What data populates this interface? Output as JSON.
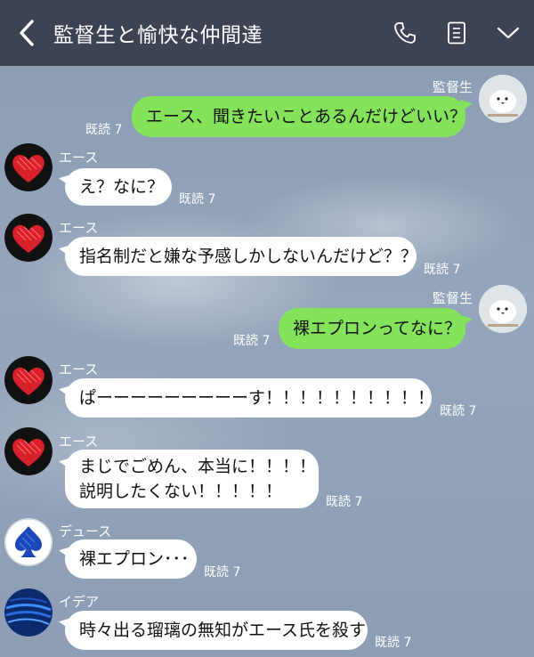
{
  "header": {
    "title": "監督生と愉快な仲間達",
    "back_icon": "chevron-left-icon",
    "call_icon": "phone-icon",
    "notes_icon": "notes-icon",
    "menu_icon": "chevron-down-icon"
  },
  "colors": {
    "header_bg": "#3e4354",
    "outgoing_bubble": "#84e25b",
    "incoming_bubble": "#ffffff",
    "chat_bg": "#8e9fb6"
  },
  "messages": [
    {
      "sender": "監督生",
      "direction": "out",
      "text": "エース、聞きたいことあるんだけどいい？",
      "read": "既読 7",
      "avatar": "white-bird-avatar"
    },
    {
      "sender": "エース",
      "direction": "in",
      "text": "え？なに？",
      "read": "既読 7",
      "avatar": "red-heart-avatar"
    },
    {
      "sender": "エース",
      "direction": "in",
      "text": "指名制だと嫌な予感しかしないんだけど？？",
      "read": "既読 7",
      "avatar": "red-heart-avatar"
    },
    {
      "sender": "監督生",
      "direction": "out",
      "text": "裸エプロンってなに？",
      "read": "既読 7",
      "avatar": "white-bird-avatar"
    },
    {
      "sender": "エース",
      "direction": "in",
      "text": "ぱーーーーーーーーーす！！！！！！！！！！",
      "read": "既読 7",
      "avatar": "red-heart-avatar"
    },
    {
      "sender": "エース",
      "direction": "in",
      "lines": [
        "まじでごめん、本当に！！！！",
        "説明したくない！！！！！"
      ],
      "read": "既読 7",
      "avatar": "red-heart-avatar"
    },
    {
      "sender": "デュース",
      "direction": "in",
      "text": "裸エプロン･･･",
      "read": "既読 7",
      "avatar": "blue-spade-avatar"
    },
    {
      "sender": "イデア",
      "direction": "in",
      "text": "時々出る瑠璃の無知がエース氏を殺す",
      "read": "既読 7",
      "avatar": "blue-pattern-avatar"
    }
  ]
}
